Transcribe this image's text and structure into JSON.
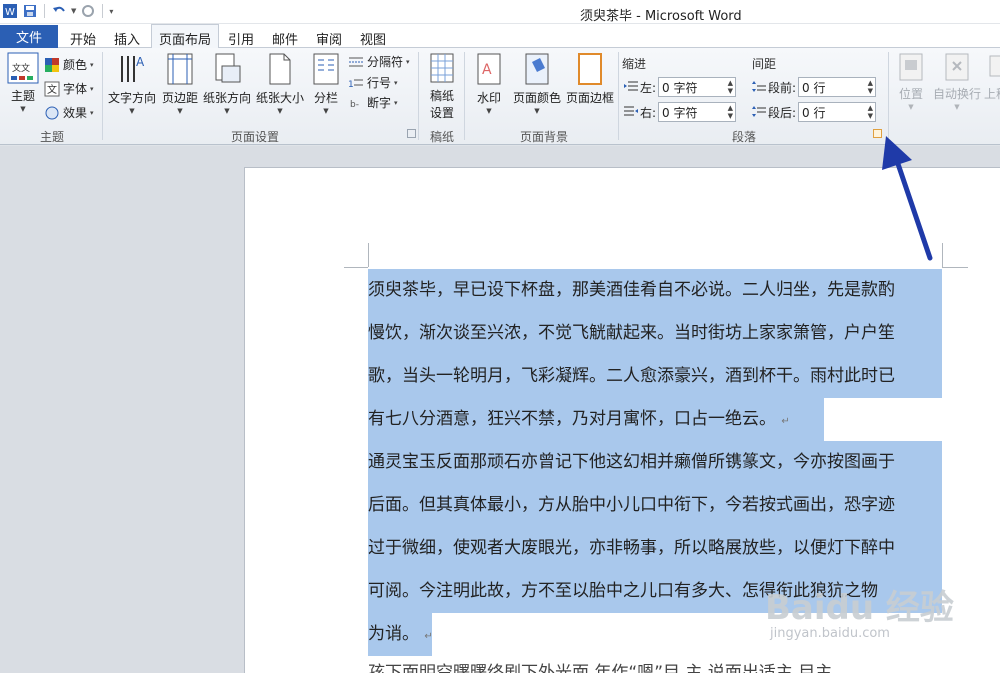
{
  "window": {
    "title": "须臾茶毕 - Microsoft Word"
  },
  "tabs": {
    "file": "文件",
    "items": [
      "开始",
      "插入",
      "页面布局",
      "引用",
      "邮件",
      "审阅",
      "视图"
    ],
    "active_index": 2
  },
  "ribbon": {
    "theme": {
      "main": "主题",
      "colors": "颜色",
      "fonts": "字体",
      "effects": "效果",
      "group": "主题"
    },
    "page_setup": {
      "text_direction": "文字方向",
      "margins": "页边距",
      "orientation": "纸张方向",
      "size": "纸张大小",
      "columns": "分栏",
      "breaks": "分隔符",
      "line_numbers": "行号",
      "hyphenation": "断字",
      "group": "页面设置"
    },
    "manuscript": {
      "button": "稿纸\n设置",
      "button_line1": "稿纸",
      "button_line2": "设置",
      "group": "稿纸"
    },
    "page_background": {
      "watermark": "水印",
      "page_color": "页面颜色",
      "page_borders": "页面边框",
      "group": "页面背景"
    },
    "paragraph": {
      "indent_header": "缩进",
      "spacing_header": "间距",
      "left_label": "左:",
      "left_value": "0 字符",
      "right_label": "右:",
      "right_value": "0 字符",
      "before_label": "段前:",
      "before_value": "0 行",
      "after_label": "段后:",
      "after_value": "0 行",
      "group": "段落"
    },
    "arrange": {
      "position": "位置",
      "wrap": "自动换行",
      "forward": "上移"
    }
  },
  "document": {
    "lines": [
      "须臾茶毕，早已设下杯盘，那美酒佳肴自不必说。二人归坐，先是款酌",
      "慢饮，渐次谈至兴浓，不觉飞觥献起来。当时街坊上家家箫管，户户笙",
      "歌，当头一轮明月，飞彩凝辉。二人愈添豪兴，酒到杯干。雨村此时已",
      "有七八分酒意，狂兴不禁，乃对月寓怀，口占一绝云。",
      "通灵宝玉反面那顽石亦曾记下他这幻相并癞僧所镌篆文，今亦按图画于",
      "后面。但其真体最小，方从胎中小儿口中衔下，今若按式画出，恐字迹",
      "过于微细，使观者大废眼光，亦非畅事，所以略展放些，以便灯下醉中",
      "可阅。今注明此故，方不至以胎中之儿口有多大、怎得衔此狼犺之物",
      "为诮。",
      "孩下面明空曙曙终剧下外光面 年作“嗯”目 主 说面出适主 目主"
    ],
    "paragraph_mark": "↵"
  },
  "watermark": {
    "brand": "Baidu 经验",
    "url": "jingyan.baidu.com"
  },
  "colors": {
    "file_tab": "#2b5fb4",
    "selection": "#a9c8ec",
    "arrow": "#1f3aa8"
  }
}
